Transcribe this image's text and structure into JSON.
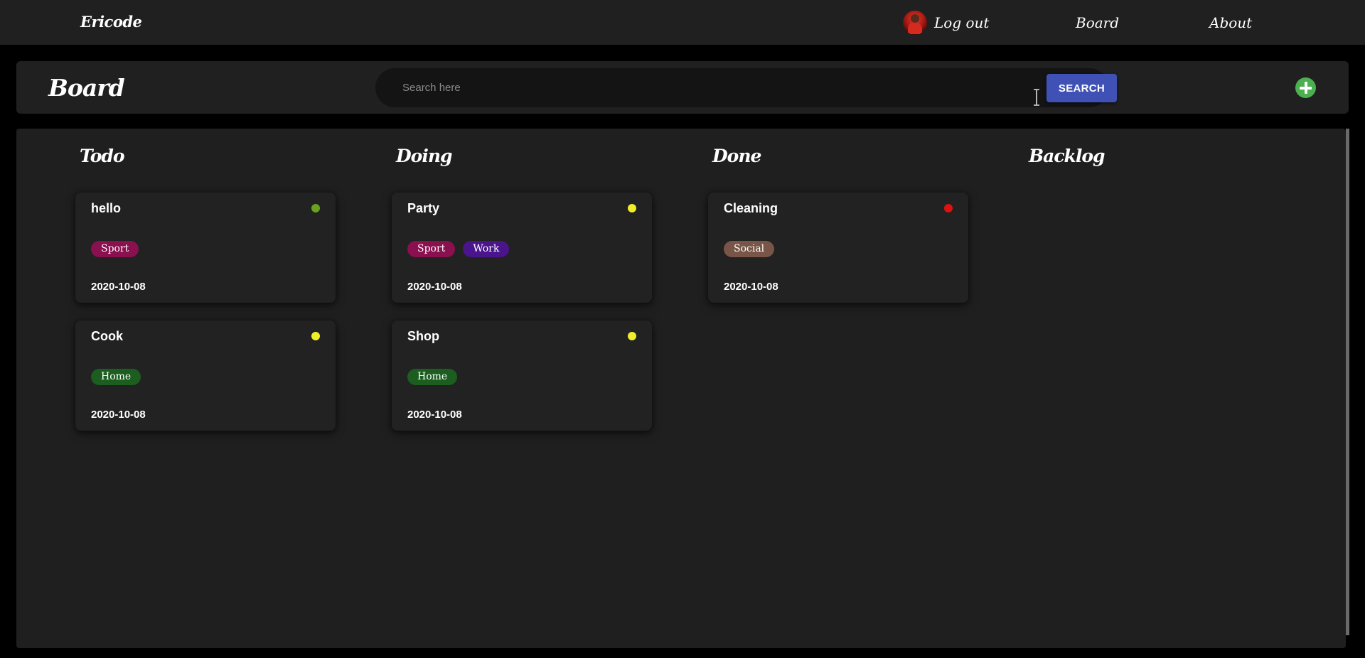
{
  "nav": {
    "brand": "Ericode",
    "logout_label": "Log out",
    "board_label": "Board",
    "about_label": "About"
  },
  "header": {
    "title": "Board",
    "search_placeholder": "Search here",
    "search_value": "",
    "search_button": "SEARCH",
    "add_icon": "plus-circle-icon",
    "add_color": "#4caf50"
  },
  "colors": {
    "accent": "#3f51b5",
    "priority_low": "#6aa220",
    "priority_medium": "#f0ee2a",
    "priority_high": "#e01010",
    "tag_sport": "#8a1050",
    "tag_work": "#4a148c",
    "tag_home": "#1b5e20",
    "tag_social": "#795548"
  },
  "columns": [
    {
      "title": "Todo",
      "cards": [
        {
          "title": "hello",
          "status_color": "#6aa220",
          "tags": [
            {
              "label": "Sport",
              "color": "#8a1050"
            }
          ],
          "date": "2020-10-08"
        },
        {
          "title": "Cook",
          "status_color": "#f0ee2a",
          "tags": [
            {
              "label": "Home",
              "color": "#1b5e20"
            }
          ],
          "date": "2020-10-08"
        }
      ]
    },
    {
      "title": "Doing",
      "cards": [
        {
          "title": "Party",
          "status_color": "#f0ee2a",
          "tags": [
            {
              "label": "Sport",
              "color": "#8a1050"
            },
            {
              "label": "Work",
              "color": "#4a148c"
            }
          ],
          "date": "2020-10-08"
        },
        {
          "title": "Shop",
          "status_color": "#f0ee2a",
          "tags": [
            {
              "label": "Home",
              "color": "#1b5e20"
            }
          ],
          "date": "2020-10-08"
        }
      ]
    },
    {
      "title": "Done",
      "cards": [
        {
          "title": "Cleaning",
          "status_color": "#e01010",
          "tags": [
            {
              "label": "Social",
              "color": "#795548"
            }
          ],
          "date": "2020-10-08"
        }
      ]
    },
    {
      "title": "Backlog",
      "cards": []
    }
  ]
}
